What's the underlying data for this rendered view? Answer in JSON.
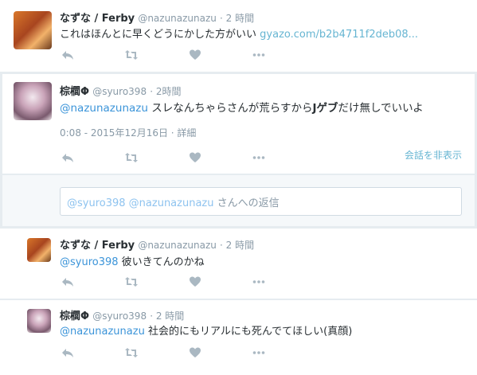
{
  "tweets": [
    {
      "name": "なずな / Ferby",
      "handle": "@nazunazunazu",
      "time": "· 2 時間",
      "text": "これはほんとに早くどうにかした方がいい",
      "link": "gyazo.com/b2b4711f2deb08..."
    },
    {
      "name": "棕櫚Φ",
      "handle": "@syuro398",
      "time": "· 2時間",
      "mention": "@nazunazunazu",
      "text_a": " スレなんちゃらさんが荒らすから",
      "text_bold": "Jゲブ",
      "text_b": "だけ無しでいいよ",
      "meta": "0:08 - 2015年12月16日 · 詳細",
      "hide_conversation": "会話を非表示"
    },
    {
      "name": "なずな / Ferby",
      "handle": "@nazunazunazu",
      "time": "· 2 時間",
      "mention": "@syuro398",
      "text": " 彼いきてんのかね"
    },
    {
      "name": "棕櫚Φ",
      "handle": "@syuro398",
      "time": "· 2 時間",
      "mention": "@nazunazunazu",
      "text": " 社会的にもリアルにも死んでてほしい(真顔)"
    }
  ],
  "reply_box": {
    "mention_1": "@syuro398",
    "mention_2": "@nazunazunazu",
    "suffix": " さんへの返信"
  },
  "icons": [
    "reply-icon",
    "retweet-icon",
    "like-icon",
    "more-icon"
  ],
  "colors": {
    "link": "#66b5d2",
    "mention": "#3b94d9",
    "muted": "#8899a6",
    "icon": "#aab8c2",
    "background": "#e6ecf0"
  }
}
